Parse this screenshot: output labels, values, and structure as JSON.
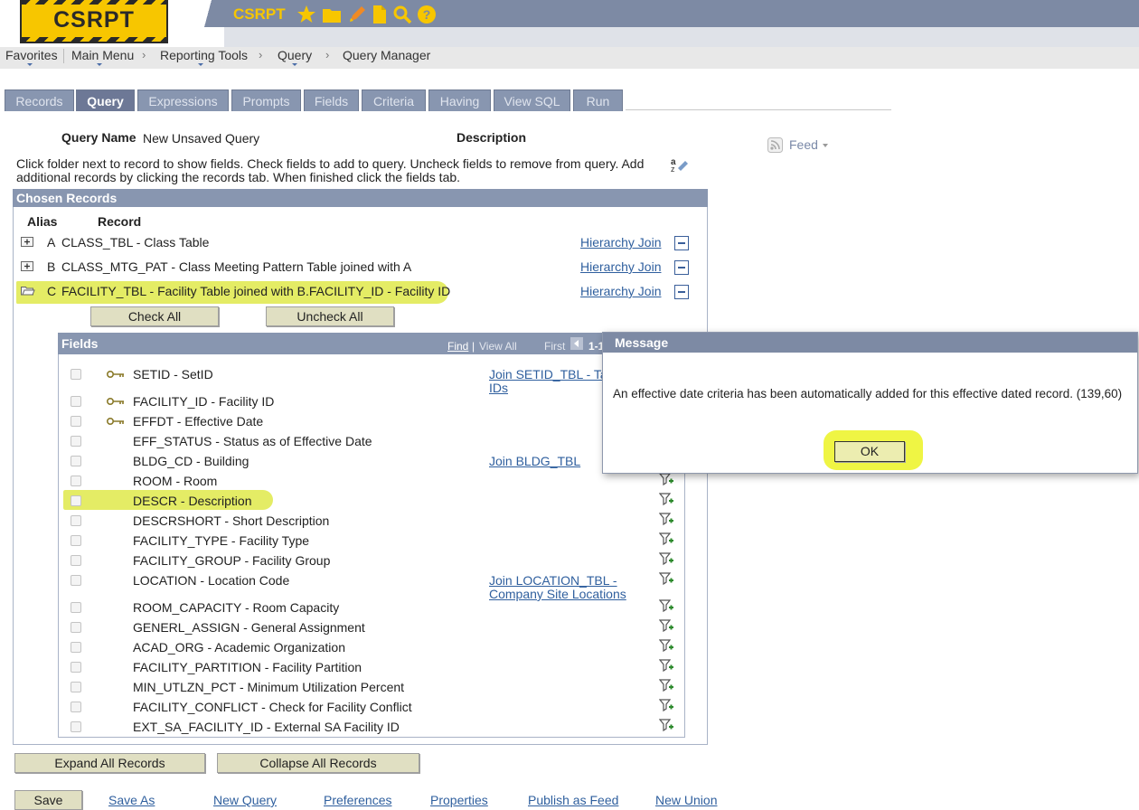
{
  "header": {
    "logo_text": "CSRPT",
    "app_name": "CSRPT",
    "icons": [
      "star-icon",
      "folder-icon",
      "pencil-icon",
      "document-icon",
      "search-icon",
      "help-icon"
    ],
    "accent_color": "#f7c600",
    "bar_color": "#7d8aa4"
  },
  "breadcrumb": {
    "favorites": "Favorites",
    "main_menu": "Main Menu",
    "reporting_tools": "Reporting Tools",
    "query": "Query",
    "query_manager": "Query Manager",
    "separator": "›"
  },
  "tabs": [
    {
      "label": "Records",
      "active": false
    },
    {
      "label": "Query",
      "active": true
    },
    {
      "label": "Expressions",
      "active": false
    },
    {
      "label": "Prompts",
      "active": false
    },
    {
      "label": "Fields",
      "active": false
    },
    {
      "label": "Criteria",
      "active": false
    },
    {
      "label": "Having",
      "active": false
    },
    {
      "label": "View SQL",
      "active": false
    },
    {
      "label": "Run",
      "active": false
    }
  ],
  "query": {
    "name_label": "Query Name",
    "name_value": "New Unsaved Query",
    "description_label": "Description",
    "feed_label": "Feed",
    "instructions_line1": "Click folder next to record to show fields. Check fields to add to query. Uncheck fields to remove from query. Add",
    "instructions_line2": "additional records by clicking the records tab. When finished click the fields tab."
  },
  "chosen_records": {
    "title": "Chosen Records",
    "alias_header": "Alias",
    "record_header": "Record",
    "rows": [
      {
        "alias": "A",
        "record": "CLASS_TBL - Class Table",
        "join": "Hierarchy Join"
      },
      {
        "alias": "B",
        "record": "CLASS_MTG_PAT - Class Meeting Pattern Table joined with A",
        "join": "Hierarchy Join"
      },
      {
        "alias": "C",
        "record": "FACILITY_TBL - Facility Table joined with B.FACILITY_ID - Facility ID",
        "join": "Hierarchy Join"
      }
    ],
    "check_all": "Check All",
    "uncheck_all": "Uncheck All"
  },
  "fields_panel": {
    "title": "Fields",
    "find": "Find",
    "view_all": "View All",
    "first": "First",
    "range": "1-1",
    "rows": [
      {
        "name": "SETID - SetID",
        "key": true,
        "join": "Join SETID_TBL - Ta",
        "join2": "IDs"
      },
      {
        "name": "FACILITY_ID - Facility ID",
        "key": true,
        "join": "",
        "join2": ""
      },
      {
        "name": "EFFDT - Effective Date",
        "key": true,
        "join": "",
        "join2": ""
      },
      {
        "name": "EFF_STATUS - Status as of Effective Date",
        "key": false,
        "join": "",
        "join2": ""
      },
      {
        "name": "BLDG_CD - Building",
        "key": false,
        "join": "Join BLDG_TBL",
        "join2": ""
      },
      {
        "name": "ROOM - Room",
        "key": false,
        "join": "",
        "join2": ""
      },
      {
        "name": "DESCR - Description",
        "key": false,
        "join": "",
        "join2": ""
      },
      {
        "name": "DESCRSHORT - Short Description",
        "key": false,
        "join": "",
        "join2": ""
      },
      {
        "name": "FACILITY_TYPE - Facility Type",
        "key": false,
        "join": "",
        "join2": ""
      },
      {
        "name": "FACILITY_GROUP - Facility Group",
        "key": false,
        "join": "",
        "join2": ""
      },
      {
        "name": "LOCATION - Location Code",
        "key": false,
        "join": "Join LOCATION_TBL -",
        "join2": "Company Site Locations"
      },
      {
        "name": "ROOM_CAPACITY - Room Capacity",
        "key": false,
        "join": "",
        "join2": ""
      },
      {
        "name": "GENERL_ASSIGN - General Assignment",
        "key": false,
        "join": "",
        "join2": ""
      },
      {
        "name": "ACAD_ORG - Academic Organization",
        "key": false,
        "join": "",
        "join2": ""
      },
      {
        "name": "FACILITY_PARTITION - Facility Partition",
        "key": false,
        "join": "",
        "join2": ""
      },
      {
        "name": "MIN_UTLZN_PCT - Minimum Utilization Percent",
        "key": false,
        "join": "",
        "join2": ""
      },
      {
        "name": "FACILITY_CONFLICT - Check for Facility Conflict",
        "key": false,
        "join": "",
        "join2": ""
      },
      {
        "name": "EXT_SA_FACILITY_ID - External SA Facility ID",
        "key": false,
        "join": "",
        "join2": ""
      }
    ]
  },
  "buttons": {
    "expand_all": "Expand All Records",
    "collapse_all": "Collapse All Records",
    "save": "Save"
  },
  "footer_links": [
    "Save As",
    "New Query",
    "Preferences",
    "Properties",
    "Publish as Feed",
    "New Union"
  ],
  "dialog": {
    "title": "Message",
    "message": "An effective date criteria has been automatically added for this effective dated record. (139,60)",
    "ok": "OK"
  }
}
